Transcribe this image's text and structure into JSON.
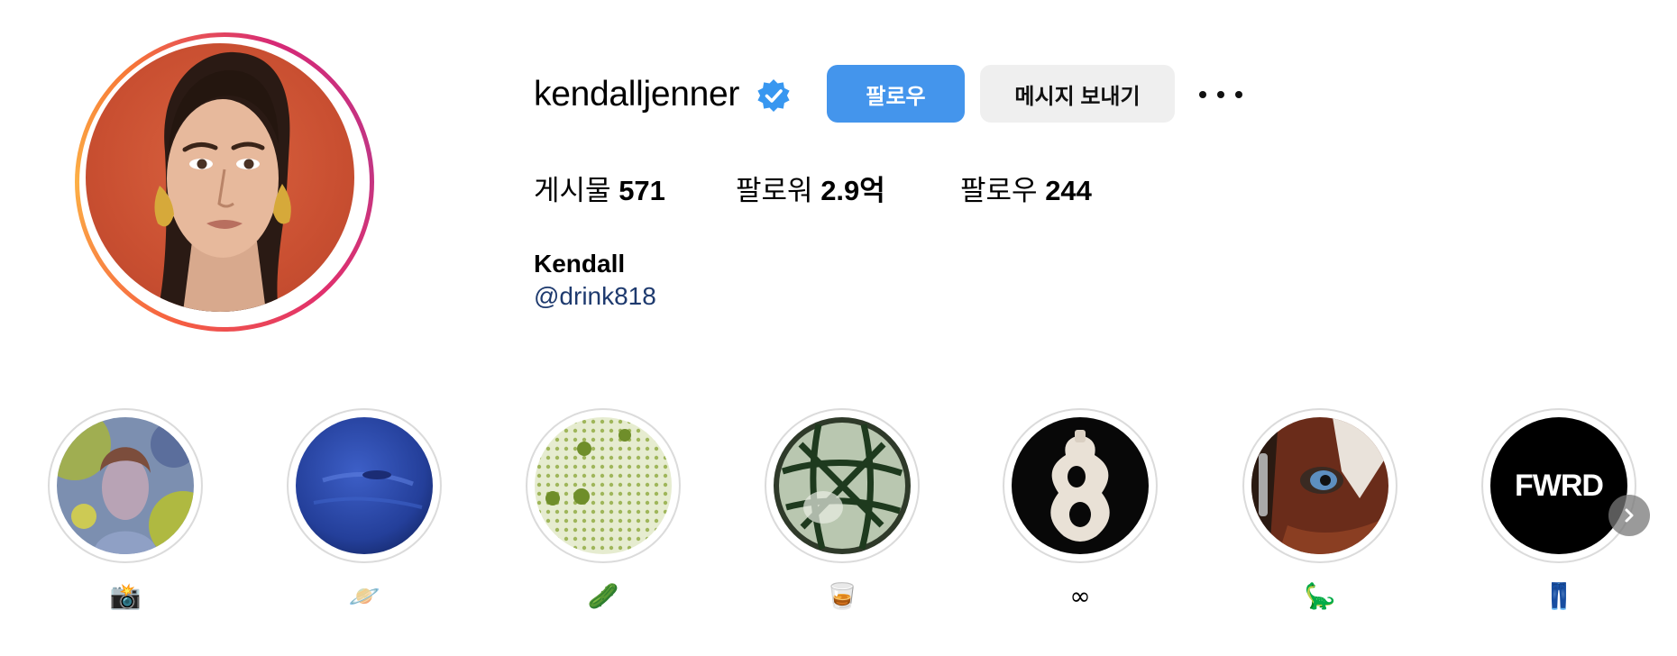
{
  "profile": {
    "username": "kendalljenner",
    "verified": true,
    "buttons": {
      "follow": "팔로우",
      "message": "메시지 보내기"
    },
    "stats": {
      "posts_label": "게시물",
      "posts_value": "571",
      "followers_label": "팔로워",
      "followers_value": "2.9억",
      "following_label": "팔로우",
      "following_value": "244"
    },
    "full_name": "Kendall",
    "bio_link": "@drink818"
  },
  "highlights": [
    {
      "label": "📸",
      "icon": "portrait-green-image"
    },
    {
      "label": "🪐",
      "icon": "blue-planet-image"
    },
    {
      "label": "🥒",
      "icon": "green-cells-image"
    },
    {
      "label": "🥃",
      "icon": "green-sphere-image"
    },
    {
      "label": "∞",
      "icon": "ceramic-eight-image"
    },
    {
      "label": "🦕",
      "icon": "horse-eye-image"
    },
    {
      "label": "👖",
      "icon": "fwrd-logo",
      "logo_text": "FWRD"
    }
  ],
  "colors": {
    "follow_button": "#4495ec",
    "message_button": "#efefef",
    "link": "#1e3a6e",
    "verified_badge": "#3897f0"
  }
}
